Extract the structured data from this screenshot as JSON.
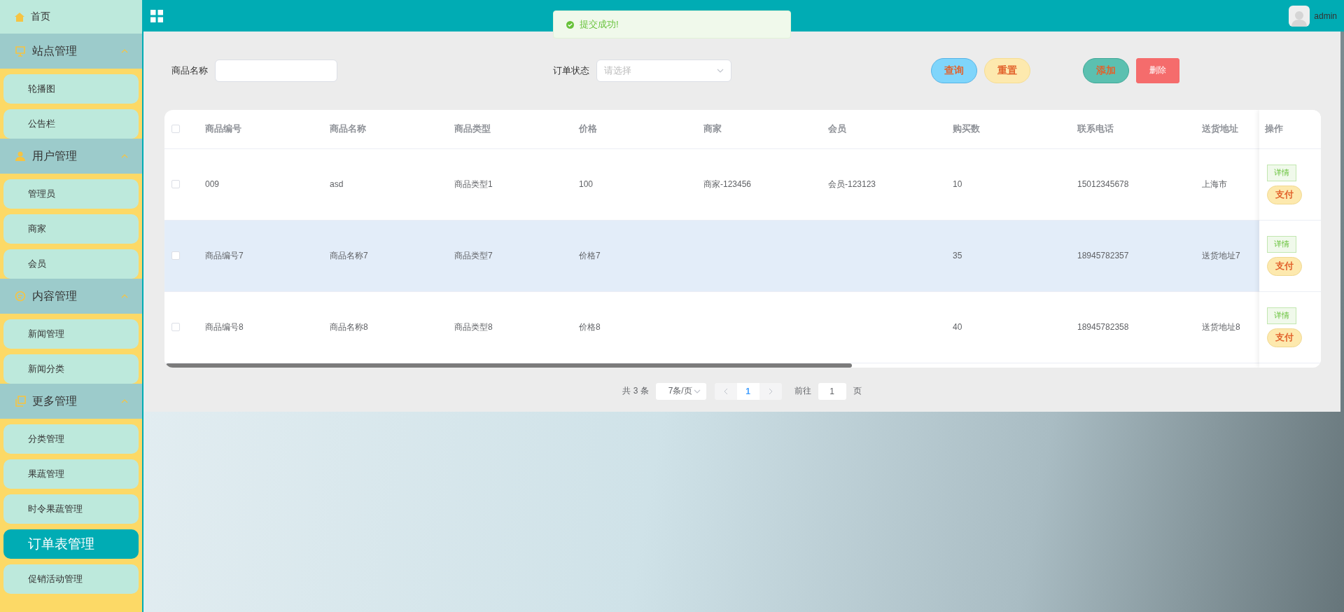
{
  "sidebar": {
    "home": {
      "label": "首页"
    },
    "groups": [
      {
        "label": "站点管理",
        "expanded": true,
        "items": [
          {
            "label": "轮播图",
            "selected": false
          },
          {
            "label": "公告栏",
            "selected": false
          }
        ]
      },
      {
        "label": "用户管理",
        "expanded": true,
        "items": [
          {
            "label": "管理员",
            "selected": false
          },
          {
            "label": "商家",
            "selected": false
          },
          {
            "label": "会员",
            "selected": false
          }
        ]
      },
      {
        "label": "内容管理",
        "expanded": true,
        "items": [
          {
            "label": "新闻管理",
            "selected": false
          },
          {
            "label": "新闻分类",
            "selected": false
          }
        ]
      },
      {
        "label": "更多管理",
        "expanded": true,
        "items": [
          {
            "label": "分类管理",
            "selected": false
          },
          {
            "label": "果蔬管理",
            "selected": false
          },
          {
            "label": "时令果蔬管理",
            "selected": false
          },
          {
            "label": "订单表管理",
            "selected": true
          },
          {
            "label": "促销活动管理",
            "selected": false
          }
        ]
      }
    ]
  },
  "topbar": {
    "user": "admin"
  },
  "toast": {
    "message": "提交成功!"
  },
  "filters": [
    {
      "label": "商品名称",
      "kind": "input"
    },
    {
      "label": "订单状态",
      "kind": "select",
      "placeholder": "请选择"
    }
  ],
  "buttons": [
    {
      "label": "查询",
      "kind": "search"
    },
    {
      "label": "重置",
      "kind": "reset"
    },
    {
      "label": "添加",
      "kind": "add"
    },
    {
      "label": "删除",
      "kind": "delete"
    }
  ],
  "table": {
    "all_checked": false,
    "columns": [
      "商品编号",
      "商品名称",
      "商品类型",
      "价格",
      "商家",
      "会员",
      "购买数",
      "联系电话",
      "送货地址"
    ],
    "actions_column": "操作",
    "rows": [
      {
        "checked": false,
        "highlighted": false,
        "cells": [
          "009",
          "asd",
          "商品类型1",
          "100",
          "商家-123456",
          "会员-123123",
          "10",
          "15012345678",
          "上海市"
        ],
        "actions": [
          "详情",
          "支付"
        ]
      },
      {
        "checked": false,
        "highlighted": true,
        "cells": [
          "商品编号7",
          "商品名称7",
          "商品类型7",
          "价格7",
          "",
          "",
          "35",
          "18945782357",
          "送货地址7"
        ],
        "actions": [
          "详情",
          "支付"
        ]
      },
      {
        "checked": false,
        "highlighted": false,
        "cells": [
          "商品编号8",
          "商品名称8",
          "商品类型8",
          "价格8",
          "",
          "",
          "40",
          "18945782358",
          "送货地址8"
        ],
        "actions": [
          "详情",
          "支付"
        ]
      }
    ]
  },
  "pagination": {
    "total": "共 3 条",
    "page_size": "7条/页",
    "pages": [
      {
        "label": "1",
        "selected": true
      }
    ],
    "goto_label": "前往",
    "goto_value": "1",
    "goto_suffix": "页"
  }
}
